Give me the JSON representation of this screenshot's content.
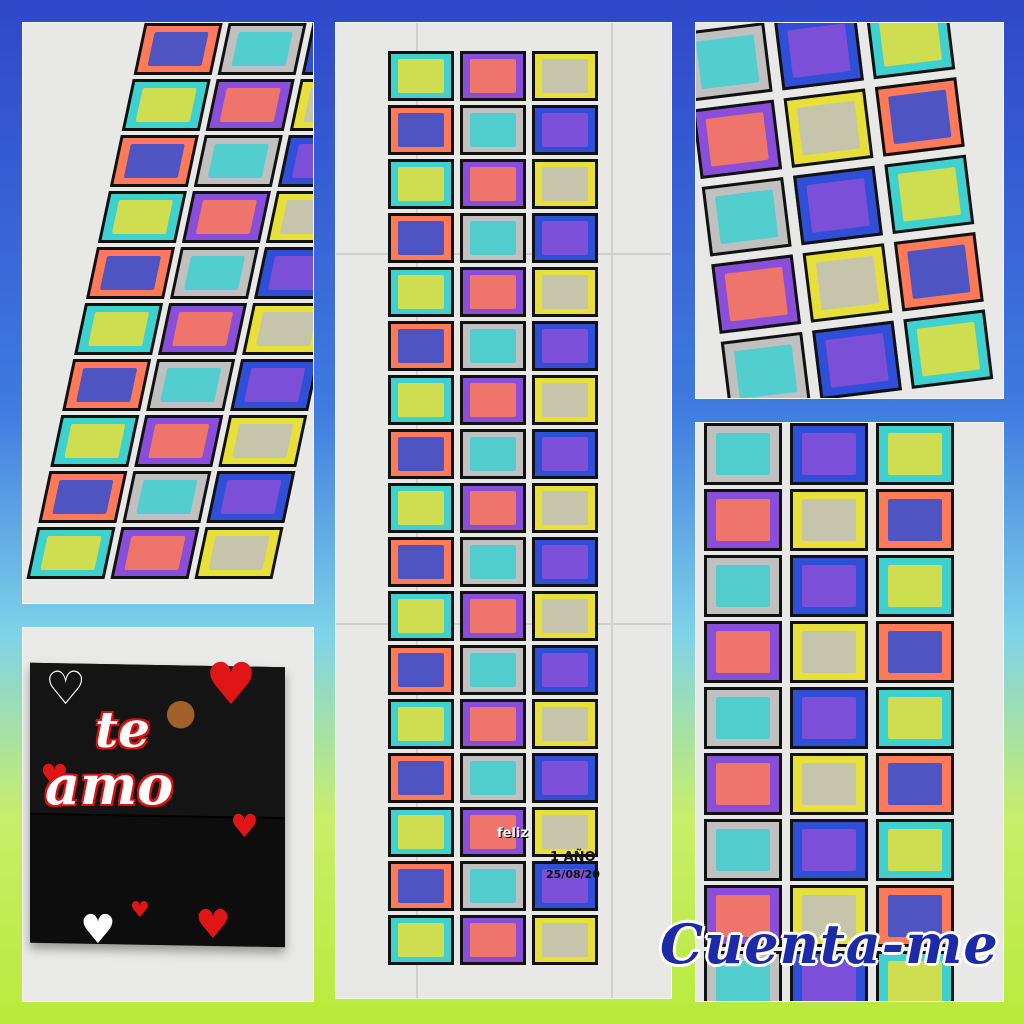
{
  "box": {
    "text_line1": "te",
    "text_line2": "amo"
  },
  "logo": {
    "text": "Cuenta-me"
  },
  "tile_labels": {
    "anniversary": "1 AÑO",
    "date": "25/08/20",
    "feliz": "feliz"
  },
  "palette": [
    "#2f4fd6",
    "#f06bb3",
    "#3fd0d0",
    "#f5a623",
    "#8a4fd8",
    "#ffffff",
    "#e8e03a",
    "#2fbf5a",
    "#ff7a59",
    "#5b6cf0",
    "#c0c0c0",
    "#f7d9e8"
  ]
}
